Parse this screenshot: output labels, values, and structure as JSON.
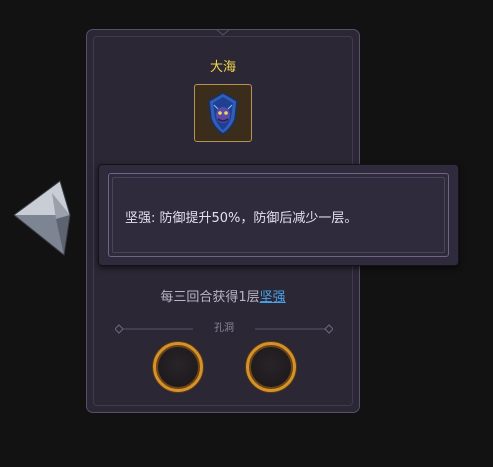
{
  "item": {
    "name": "大海",
    "icon": "blue-demon-shield-icon"
  },
  "tooltip": {
    "text": "坚强: 防御提升50%，防御后减少一层。"
  },
  "effect": {
    "prefix": "每三回合获得1层",
    "keyword": "坚强"
  },
  "sockets": {
    "label": "孔洞",
    "count": 2
  },
  "colors": {
    "title": "#f2d64a",
    "link": "#4aa3e8",
    "socket_ring": "#d6922a"
  }
}
